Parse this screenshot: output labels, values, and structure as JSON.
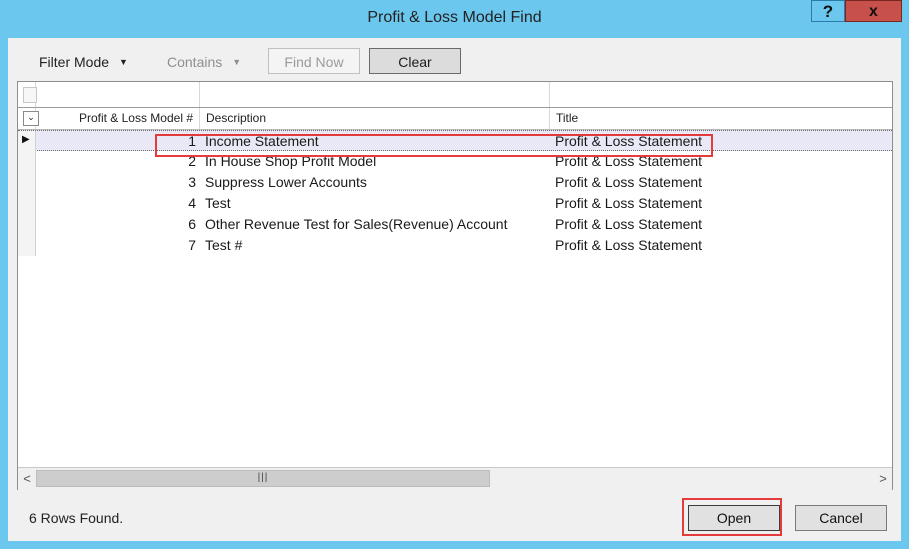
{
  "window": {
    "title": "Profit & Loss Model Find",
    "help_label": "?",
    "close_label": "x"
  },
  "toolbar": {
    "filter_mode_label": "Filter Mode",
    "contains_label": "Contains",
    "find_now_label": "Find Now",
    "clear_label": "Clear"
  },
  "grid": {
    "columns": [
      "Profit & Loss Model #",
      "Description",
      "Title"
    ],
    "rows": [
      {
        "num": "1",
        "description": "Income Statement",
        "title": "Profit & Loss Statement"
      },
      {
        "num": "2",
        "description": "In House Shop Profit Model",
        "title": "Profit & Loss Statement"
      },
      {
        "num": "3",
        "description": "Suppress Lower Accounts",
        "title": "Profit & Loss Statement"
      },
      {
        "num": "4",
        "description": "Test",
        "title": "Profit & Loss Statement"
      },
      {
        "num": "6",
        "description": "Other Revenue Test for Sales(Revenue) Account",
        "title": "Profit & Loss Statement"
      },
      {
        "num": "7",
        "description": "Test #",
        "title": "Profit & Loss Statement"
      }
    ],
    "selected_row_index": 0
  },
  "footer": {
    "status": "6 Rows Found.",
    "open_label": "Open",
    "cancel_label": "Cancel"
  },
  "icons": {
    "dropdown": "chevron-down-icon",
    "scroll_left": "chevron-left-icon",
    "scroll_right": "chevron-right-icon",
    "row_pointer": "triangle-right-icon"
  },
  "colors": {
    "title_bar": "#6cc7ee",
    "close_button": "#c7504a",
    "highlight": "#e53b3b",
    "selected_row": "#e8e8f6"
  }
}
